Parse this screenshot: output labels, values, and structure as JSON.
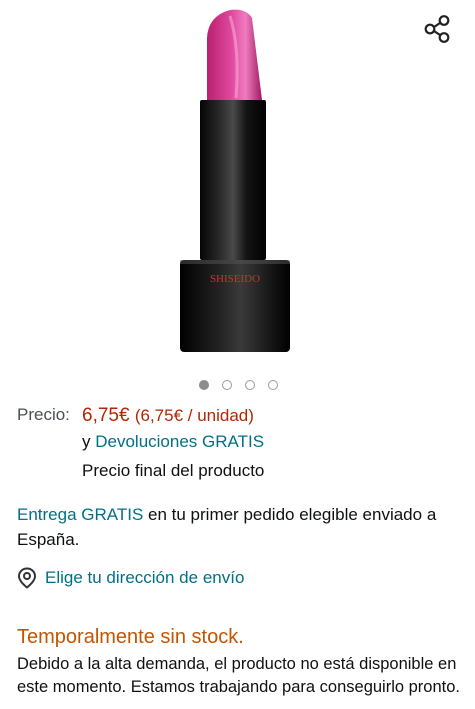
{
  "product": {
    "brand_logo": "SHISEIDO",
    "share_icon": "share-icon",
    "carousel": {
      "total": 4,
      "active": 0
    }
  },
  "price": {
    "label": "Precio:",
    "amount": "6,75€",
    "per_unit": "(6,75€ / unidad)",
    "returns_prefix": "y",
    "returns_link": "Devoluciones GRATIS",
    "final_note": "Precio final del producto"
  },
  "delivery": {
    "link": "Entrega GRATIS",
    "text": " en tu primer pedido elegible enviado a España."
  },
  "address": {
    "icon": "location-pin-icon",
    "link": "Elige tu dirección de envío"
  },
  "stock": {
    "title": "Temporalmente sin stock.",
    "description": "Debido a la alta demanda, el producto no está disponible en este momento. Estamos trabajando para conseguirlo pronto."
  },
  "colors": {
    "price": "#b12704",
    "link": "#007185",
    "stock": "#c45500",
    "lipstick": "#d6318f"
  }
}
